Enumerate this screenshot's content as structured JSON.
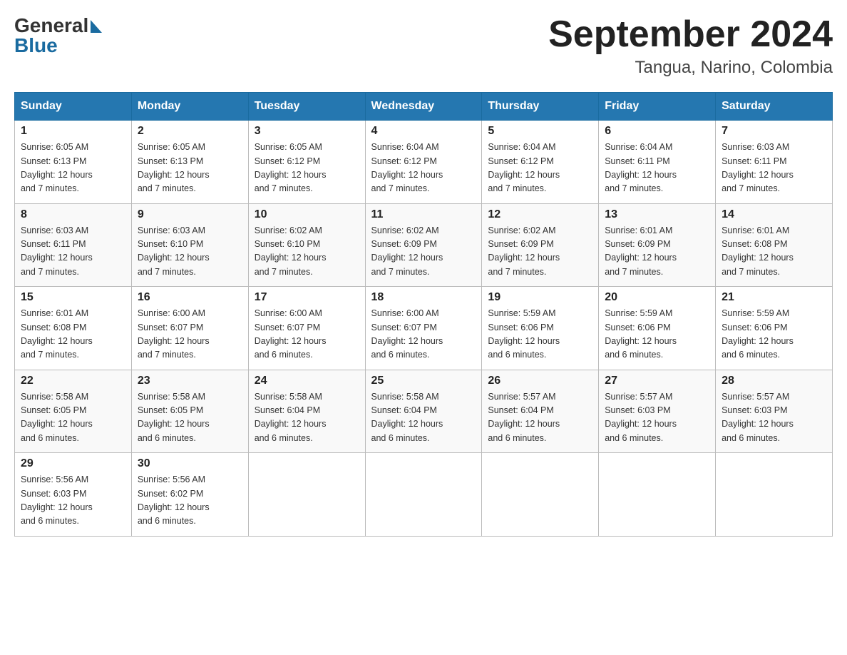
{
  "header": {
    "title": "September 2024",
    "subtitle": "Tangua, Narino, Colombia",
    "logo_general": "General",
    "logo_blue": "Blue"
  },
  "weekdays": [
    "Sunday",
    "Monday",
    "Tuesday",
    "Wednesday",
    "Thursday",
    "Friday",
    "Saturday"
  ],
  "weeks": [
    [
      {
        "day": "1",
        "sunrise": "6:05 AM",
        "sunset": "6:13 PM",
        "daylight": "12 hours and 7 minutes."
      },
      {
        "day": "2",
        "sunrise": "6:05 AM",
        "sunset": "6:13 PM",
        "daylight": "12 hours and 7 minutes."
      },
      {
        "day": "3",
        "sunrise": "6:05 AM",
        "sunset": "6:12 PM",
        "daylight": "12 hours and 7 minutes."
      },
      {
        "day": "4",
        "sunrise": "6:04 AM",
        "sunset": "6:12 PM",
        "daylight": "12 hours and 7 minutes."
      },
      {
        "day": "5",
        "sunrise": "6:04 AM",
        "sunset": "6:12 PM",
        "daylight": "12 hours and 7 minutes."
      },
      {
        "day": "6",
        "sunrise": "6:04 AM",
        "sunset": "6:11 PM",
        "daylight": "12 hours and 7 minutes."
      },
      {
        "day": "7",
        "sunrise": "6:03 AM",
        "sunset": "6:11 PM",
        "daylight": "12 hours and 7 minutes."
      }
    ],
    [
      {
        "day": "8",
        "sunrise": "6:03 AM",
        "sunset": "6:11 PM",
        "daylight": "12 hours and 7 minutes."
      },
      {
        "day": "9",
        "sunrise": "6:03 AM",
        "sunset": "6:10 PM",
        "daylight": "12 hours and 7 minutes."
      },
      {
        "day": "10",
        "sunrise": "6:02 AM",
        "sunset": "6:10 PM",
        "daylight": "12 hours and 7 minutes."
      },
      {
        "day": "11",
        "sunrise": "6:02 AM",
        "sunset": "6:09 PM",
        "daylight": "12 hours and 7 minutes."
      },
      {
        "day": "12",
        "sunrise": "6:02 AM",
        "sunset": "6:09 PM",
        "daylight": "12 hours and 7 minutes."
      },
      {
        "day": "13",
        "sunrise": "6:01 AM",
        "sunset": "6:09 PM",
        "daylight": "12 hours and 7 minutes."
      },
      {
        "day": "14",
        "sunrise": "6:01 AM",
        "sunset": "6:08 PM",
        "daylight": "12 hours and 7 minutes."
      }
    ],
    [
      {
        "day": "15",
        "sunrise": "6:01 AM",
        "sunset": "6:08 PM",
        "daylight": "12 hours and 7 minutes."
      },
      {
        "day": "16",
        "sunrise": "6:00 AM",
        "sunset": "6:07 PM",
        "daylight": "12 hours and 7 minutes."
      },
      {
        "day": "17",
        "sunrise": "6:00 AM",
        "sunset": "6:07 PM",
        "daylight": "12 hours and 6 minutes."
      },
      {
        "day": "18",
        "sunrise": "6:00 AM",
        "sunset": "6:07 PM",
        "daylight": "12 hours and 6 minutes."
      },
      {
        "day": "19",
        "sunrise": "5:59 AM",
        "sunset": "6:06 PM",
        "daylight": "12 hours and 6 minutes."
      },
      {
        "day": "20",
        "sunrise": "5:59 AM",
        "sunset": "6:06 PM",
        "daylight": "12 hours and 6 minutes."
      },
      {
        "day": "21",
        "sunrise": "5:59 AM",
        "sunset": "6:06 PM",
        "daylight": "12 hours and 6 minutes."
      }
    ],
    [
      {
        "day": "22",
        "sunrise": "5:58 AM",
        "sunset": "6:05 PM",
        "daylight": "12 hours and 6 minutes."
      },
      {
        "day": "23",
        "sunrise": "5:58 AM",
        "sunset": "6:05 PM",
        "daylight": "12 hours and 6 minutes."
      },
      {
        "day": "24",
        "sunrise": "5:58 AM",
        "sunset": "6:04 PM",
        "daylight": "12 hours and 6 minutes."
      },
      {
        "day": "25",
        "sunrise": "5:58 AM",
        "sunset": "6:04 PM",
        "daylight": "12 hours and 6 minutes."
      },
      {
        "day": "26",
        "sunrise": "5:57 AM",
        "sunset": "6:04 PM",
        "daylight": "12 hours and 6 minutes."
      },
      {
        "day": "27",
        "sunrise": "5:57 AM",
        "sunset": "6:03 PM",
        "daylight": "12 hours and 6 minutes."
      },
      {
        "day": "28",
        "sunrise": "5:57 AM",
        "sunset": "6:03 PM",
        "daylight": "12 hours and 6 minutes."
      }
    ],
    [
      {
        "day": "29",
        "sunrise": "5:56 AM",
        "sunset": "6:03 PM",
        "daylight": "12 hours and 6 minutes."
      },
      {
        "day": "30",
        "sunrise": "5:56 AM",
        "sunset": "6:02 PM",
        "daylight": "12 hours and 6 minutes."
      },
      null,
      null,
      null,
      null,
      null
    ]
  ],
  "labels": {
    "sunrise": "Sunrise:",
    "sunset": "Sunset:",
    "daylight": "Daylight:"
  }
}
